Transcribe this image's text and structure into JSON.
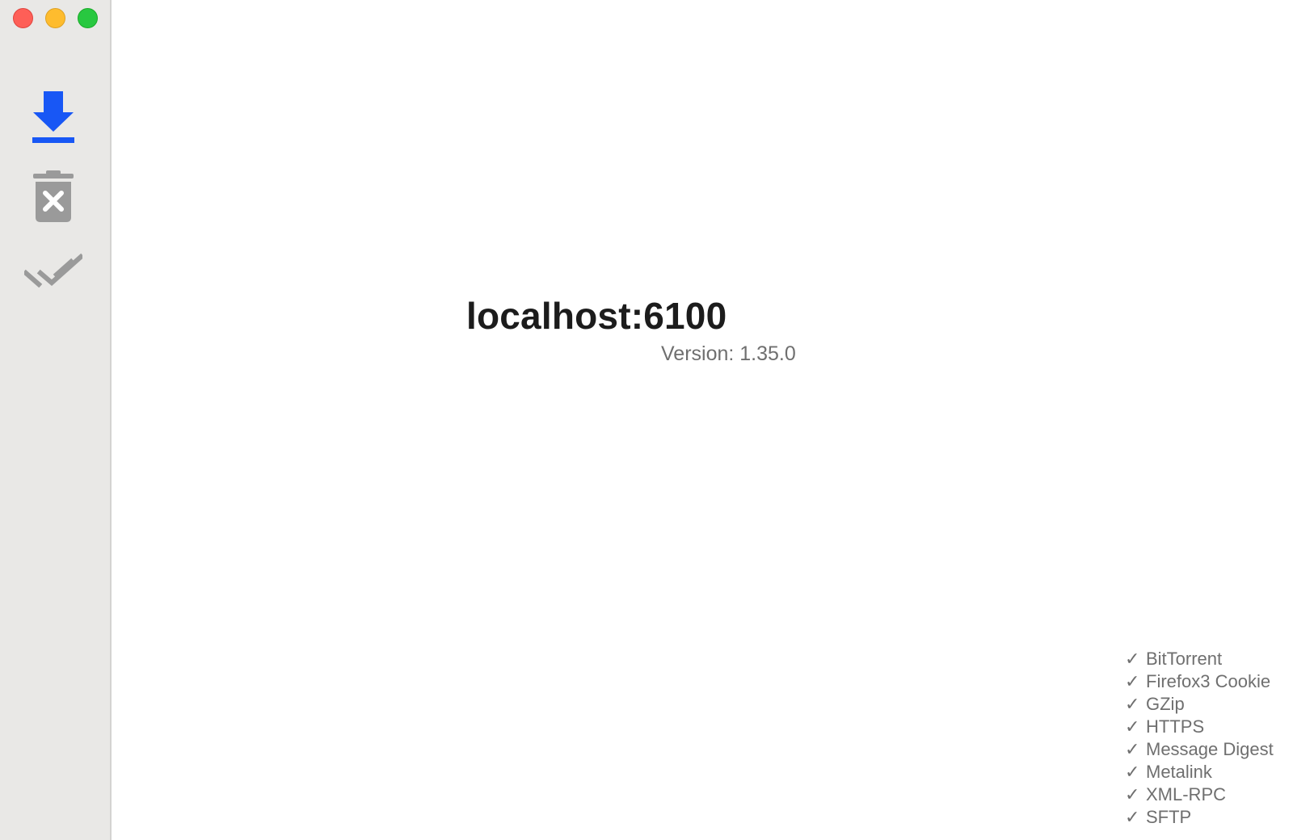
{
  "window": {
    "controls": [
      "close",
      "minimize",
      "zoom"
    ]
  },
  "sidebar": {
    "buttons": [
      {
        "icon": "download-icon",
        "color": "#1857f5"
      },
      {
        "icon": "trash-remove-icon",
        "color": "#9a9a9a"
      },
      {
        "icon": "double-check-icon",
        "color": "#9a9a9a"
      }
    ]
  },
  "main": {
    "host": "localhost:6100",
    "version": "Version: 1.35.0",
    "features": [
      {
        "check": "✓",
        "label": "BitTorrent"
      },
      {
        "check": "✓",
        "label": "Firefox3 Cookie"
      },
      {
        "check": "✓",
        "label": "GZip"
      },
      {
        "check": "✓",
        "label": "HTTPS"
      },
      {
        "check": "✓",
        "label": "Message Digest"
      },
      {
        "check": "✓",
        "label": "Metalink"
      },
      {
        "check": "✓",
        "label": "XML-RPC"
      },
      {
        "check": "✓",
        "label": "SFTP"
      }
    ]
  }
}
